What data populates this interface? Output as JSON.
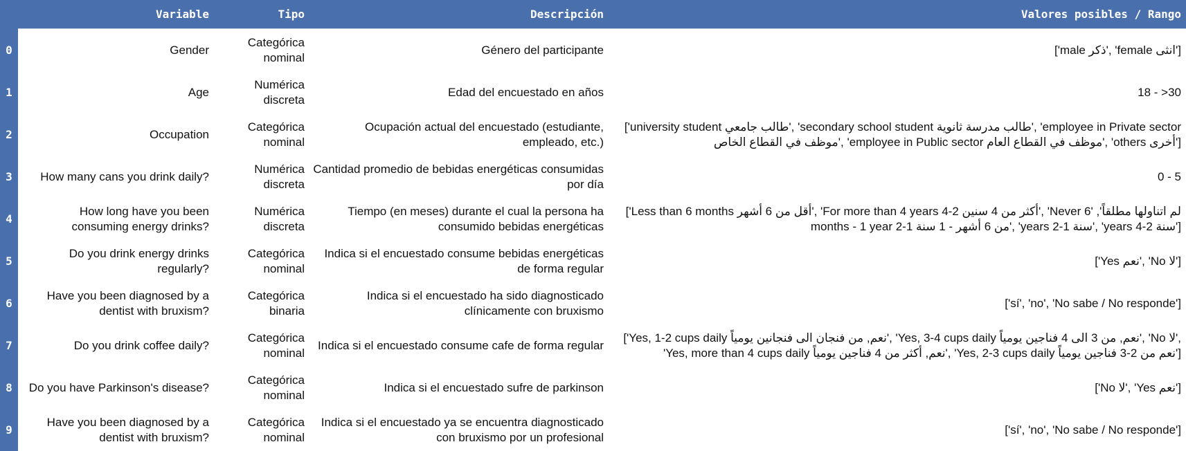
{
  "table": {
    "columns": {
      "variable": "Variable",
      "tipo": "Tipo",
      "descripcion": "Descripción",
      "valores": "Valores posibles / Rango"
    },
    "rows": [
      {
        "index": "0",
        "variable": "Gender",
        "tipo": "Categórica nominal",
        "descripcion": "Género del participante",
        "valores": "['male ذكر', 'female انثى']"
      },
      {
        "index": "1",
        "variable": "Age",
        "tipo": "Numérica discreta",
        "descripcion": "Edad del encuestado en años",
        "valores": "18 - >30"
      },
      {
        "index": "2",
        "variable": "Occupation",
        "tipo": "Categórica nominal",
        "descripcion": "Ocupación actual del encuestado (estudiante, empleado, etc.)",
        "valores": "['university student طالب جامعي', 'secondary school student طالب مدرسة ثانوية', 'employee in Private sector موظف في القطاع الخاص', 'employee in Public sector موظف في القطاع العام', 'others أخرى']"
      },
      {
        "index": "3",
        "variable": "How many cans you drink daily?",
        "tipo": "Numérica discreta",
        "descripcion": "Cantidad promedio de bebidas energéticas consumidas por día",
        "valores": "0 - 5"
      },
      {
        "index": "4",
        "variable": "How long have you been consuming energy drinks?",
        "tipo": "Numérica discreta",
        "descripcion": "Tiempo (en meses) durante el cual la persona ha consumido bebidas energéticas",
        "valores": "['Less than 6 months أقل من 6 أشهر', 'For more than 4 years 4-2 أكثر من 4 سنين', 'Never لم اتناولها مطلقاً', '6 months - 1 year 2-1 من 6 أشهر - 1 سنة', 'years 2-1 سنة', 'years 4-2 سنة']"
      },
      {
        "index": "5",
        "variable": "Do you drink energy drinks regularly?",
        "tipo": "Categórica nominal",
        "descripcion": "Indica si el encuestado consume bebidas energéticas de forma regular",
        "valores": "['Yes نعم', 'No لا']"
      },
      {
        "index": "6",
        "variable": "Have you been diagnosed by a dentist with bruxism?",
        "tipo": "Categórica binaria",
        "descripcion": "Indica si el encuestado ha sido diagnosticado clínicamente con bruxismo",
        "valores": "['sí', 'no', 'No sabe / No responde']"
      },
      {
        "index": "7",
        "variable": "Do you drink coffee daily?",
        "tipo": "Categórica nominal",
        "descripcion": "Indica si el encuestado consume cafe de forma regular",
        "valores": "['Yes, 1-2 cups daily نعم, من فنجان الى فنجانين يومياً', 'Yes, 3-4 cups daily نعم, من 3 الى 4 فناجين يومياً', 'No لا', 'Yes, more than 4 cups daily نعم, أكثر من 4 فناجين يومياً', 'Yes, 2-3 cups daily نعم من 2-3 فناجين يومياً']"
      },
      {
        "index": "8",
        "variable": "Do you have Parkinson's disease?",
        "tipo": "Categórica nominal",
        "descripcion": "Indica si el encuestado sufre de parkinson",
        "valores": "['No لا', 'Yes نعم']"
      },
      {
        "index": "9",
        "variable": "Have you been diagnosed by a dentist with bruxism?",
        "tipo": "Categórica nominal",
        "descripcion": "Indica si el encuestado ya se encuentra diagnosticado con bruxismo por un profesional",
        "valores": "['sí', 'no', 'No sabe / No responde']"
      }
    ]
  }
}
